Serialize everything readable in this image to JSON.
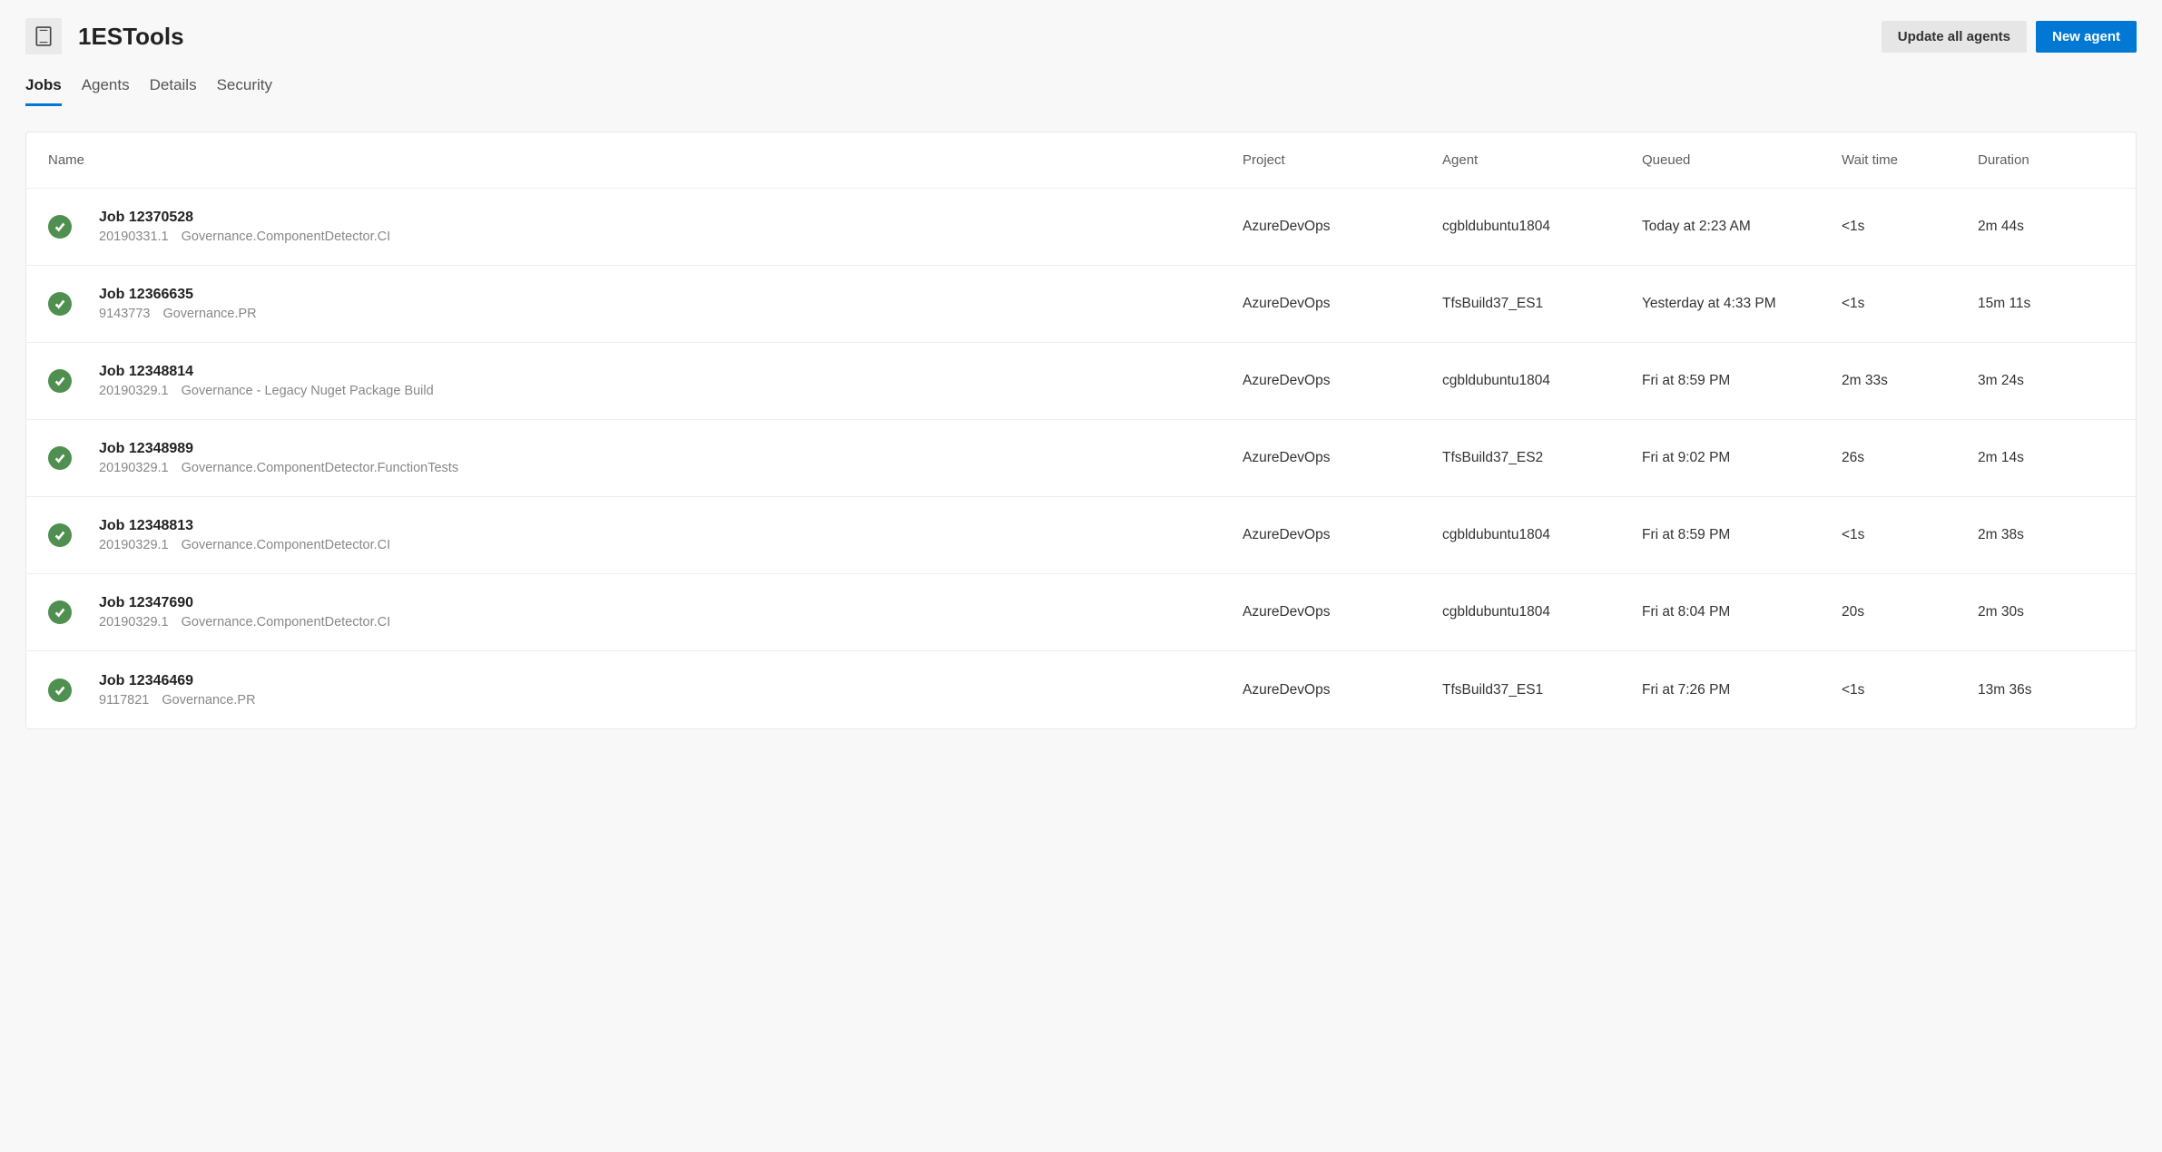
{
  "header": {
    "title": "1ESTools",
    "update_button": "Update all agents",
    "new_button": "New agent"
  },
  "tabs": [
    {
      "label": "Jobs",
      "active": true
    },
    {
      "label": "Agents",
      "active": false
    },
    {
      "label": "Details",
      "active": false
    },
    {
      "label": "Security",
      "active": false
    }
  ],
  "columns": {
    "name": "Name",
    "project": "Project",
    "agent": "Agent",
    "queued": "Queued",
    "wait": "Wait time",
    "duration": "Duration"
  },
  "jobs": [
    {
      "title": "Job 12370528",
      "build": "20190331.1",
      "pipeline": "Governance.ComponentDetector.CI",
      "project": "AzureDevOps",
      "agent": "cgbldubuntu1804",
      "queued": "Today at 2:23 AM",
      "wait": "<1s",
      "duration": "2m 44s"
    },
    {
      "title": "Job 12366635",
      "build": "9143773",
      "pipeline": "Governance.PR",
      "project": "AzureDevOps",
      "agent": "TfsBuild37_ES1",
      "queued": "Yesterday at 4:33 PM",
      "wait": "<1s",
      "duration": "15m 11s"
    },
    {
      "title": "Job 12348814",
      "build": "20190329.1",
      "pipeline": "Governance - Legacy Nuget Package Build",
      "project": "AzureDevOps",
      "agent": "cgbldubuntu1804",
      "queued": "Fri at 8:59 PM",
      "wait": "2m 33s",
      "duration": "3m 24s"
    },
    {
      "title": "Job 12348989",
      "build": "20190329.1",
      "pipeline": "Governance.ComponentDetector.FunctionTests",
      "project": "AzureDevOps",
      "agent": "TfsBuild37_ES2",
      "queued": "Fri at 9:02 PM",
      "wait": "26s",
      "duration": "2m 14s"
    },
    {
      "title": "Job 12348813",
      "build": "20190329.1",
      "pipeline": "Governance.ComponentDetector.CI",
      "project": "AzureDevOps",
      "agent": "cgbldubuntu1804",
      "queued": "Fri at 8:59 PM",
      "wait": "<1s",
      "duration": "2m 38s"
    },
    {
      "title": "Job 12347690",
      "build": "20190329.1",
      "pipeline": "Governance.ComponentDetector.CI",
      "project": "AzureDevOps",
      "agent": "cgbldubuntu1804",
      "queued": "Fri at 8:04 PM",
      "wait": "20s",
      "duration": "2m 30s"
    },
    {
      "title": "Job 12346469",
      "build": "9117821",
      "pipeline": "Governance.PR",
      "project": "AzureDevOps",
      "agent": "TfsBuild37_ES1",
      "queued": "Fri at 7:26 PM",
      "wait": "<1s",
      "duration": "13m 36s"
    }
  ]
}
